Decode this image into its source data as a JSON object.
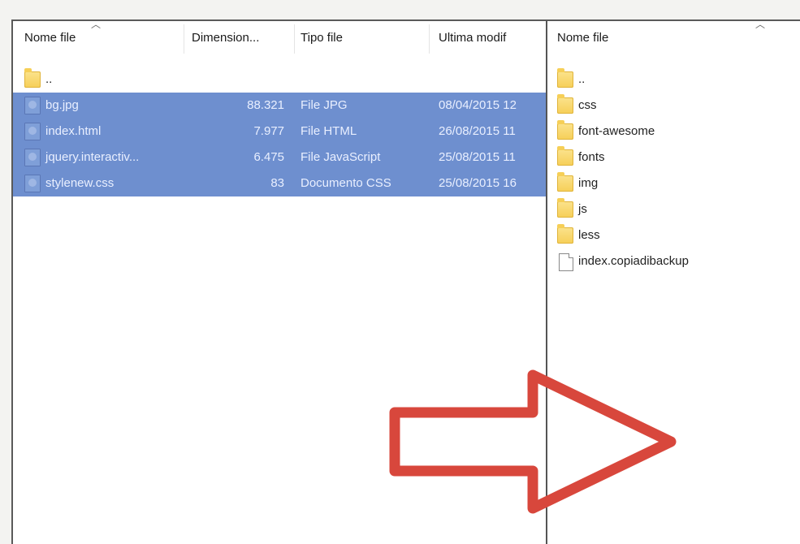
{
  "local_pane": {
    "columns": {
      "name": "Nome file",
      "size": "Dimension...",
      "type": "Tipo file",
      "modified": "Ultima modif"
    },
    "files": [
      {
        "name": "..",
        "size": "",
        "type": "",
        "modified": "",
        "icon": "parent-folder-icon",
        "selected": false
      },
      {
        "name": "bg.jpg",
        "size": "88.321",
        "type": "File JPG",
        "modified": "08/04/2015 12",
        "icon": "image-file-icon",
        "selected": true
      },
      {
        "name": "index.html",
        "size": "7.977",
        "type": "File HTML",
        "modified": "26/08/2015 11",
        "icon": "html-file-icon",
        "selected": true
      },
      {
        "name": "jquery.interactiv...",
        "size": "6.475",
        "type": "File JavaScript",
        "modified": "25/08/2015 11",
        "icon": "javascript-file-icon",
        "selected": true
      },
      {
        "name": "stylenew.css",
        "size": "83",
        "type": "Documento CSS",
        "modified": "25/08/2015 16",
        "icon": "css-file-icon",
        "selected": true
      }
    ]
  },
  "remote_pane": {
    "columns": {
      "name": "Nome file"
    },
    "files": [
      {
        "name": "..",
        "icon": "parent-folder-icon"
      },
      {
        "name": "css",
        "icon": "folder-icon"
      },
      {
        "name": "font-awesome",
        "icon": "folder-icon"
      },
      {
        "name": "fonts",
        "icon": "folder-icon"
      },
      {
        "name": "img",
        "icon": "folder-icon"
      },
      {
        "name": "js",
        "icon": "folder-icon"
      },
      {
        "name": "less",
        "icon": "folder-icon"
      },
      {
        "name": "index.copiadibackup",
        "icon": "file-icon"
      }
    ]
  },
  "colors": {
    "selection": "#6e8fcf",
    "folder": "#f6cf57",
    "arrow": "#d8473c"
  }
}
